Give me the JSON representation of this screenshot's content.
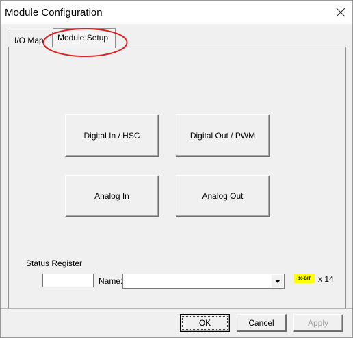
{
  "window": {
    "title": "Module Configuration"
  },
  "tabs": [
    {
      "label": "I/O Map",
      "selected": false
    },
    {
      "label": "Module Setup",
      "selected": true
    }
  ],
  "module_buttons": [
    {
      "label": "Digital In / HSC"
    },
    {
      "label": "Digital Out / PWM"
    },
    {
      "label": "Analog In"
    },
    {
      "label": "Analog Out"
    }
  ],
  "status": {
    "section_label": "Status Register",
    "register_value": "",
    "name_label": "Name:",
    "name_value": "",
    "bit_badge": "16-BIT",
    "multiplier": "x 14"
  },
  "buttons": {
    "ok": "OK",
    "cancel": "Cancel",
    "apply": "Apply",
    "apply_enabled": false
  },
  "colors": {
    "annotation": "#e02020",
    "badge": "#ffff00",
    "dialog_bg": "#f0f0f0"
  }
}
